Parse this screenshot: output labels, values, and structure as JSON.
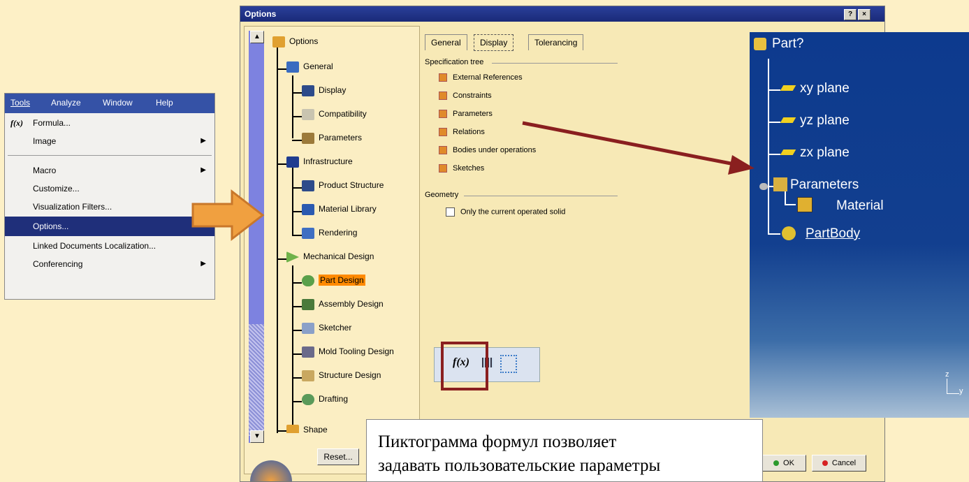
{
  "window": {
    "title": "Options"
  },
  "tree": {
    "items": [
      {
        "label": "Options"
      },
      {
        "label": "General"
      },
      {
        "label": "Display"
      },
      {
        "label": "Compatibility"
      },
      {
        "label": "Parameters"
      },
      {
        "label": "Infrastructure"
      },
      {
        "label": "Product Structure"
      },
      {
        "label": "Material Library"
      },
      {
        "label": "Rendering"
      },
      {
        "label": "Mechanical Design"
      },
      {
        "label": "Part Design"
      },
      {
        "label": "Assembly Design"
      },
      {
        "label": "Sketcher"
      },
      {
        "label": "Mold Tooling Design"
      },
      {
        "label": "Structure Design"
      },
      {
        "label": "Drafting"
      },
      {
        "label": "Shape"
      }
    ],
    "reset_label": "Reset..."
  },
  "tabs": [
    "General",
    "Display",
    "Tolerancing"
  ],
  "spec_tree": {
    "title": "Specification tree",
    "options": [
      "External References",
      "Constraints",
      "Parameters",
      "Relations",
      "Bodies under operations",
      "Sketches"
    ]
  },
  "geometry": {
    "title": "Geometry",
    "option": "Only the current operated solid"
  },
  "buttons": {
    "ok": "OK",
    "cancel": "Cancel"
  },
  "menu": {
    "bar": [
      "Tools",
      "Analyze",
      "Window",
      "Help"
    ],
    "items": [
      {
        "label": "Formula..."
      },
      {
        "label": "Image",
        "submenu": true
      },
      {
        "label": "Macro",
        "submenu": true
      },
      {
        "label": "Customize..."
      },
      {
        "label": "Visualization Filters..."
      },
      {
        "label": "Options...",
        "selected": true
      },
      {
        "label": "Linked Documents Localization..."
      },
      {
        "label": "Conferencing",
        "submenu": true
      }
    ]
  },
  "catia_tree": {
    "root": "Part?",
    "items": [
      "xy plane",
      "yz plane",
      "zx plane",
      "Parameters",
      "Material",
      "PartBody"
    ]
  },
  "toolbar_icons": {
    "formula": "f(x)"
  },
  "axes": {
    "z": "z",
    "y": "y"
  },
  "caption": {
    "line1": "Пиктограмма формул позволяет",
    "line2": "задавать пользовательские параметры"
  },
  "colors": {
    "accent_orange": "#f0a040",
    "arrow_red": "#8a1f1f",
    "catia_blue": "#0d3a8e"
  }
}
